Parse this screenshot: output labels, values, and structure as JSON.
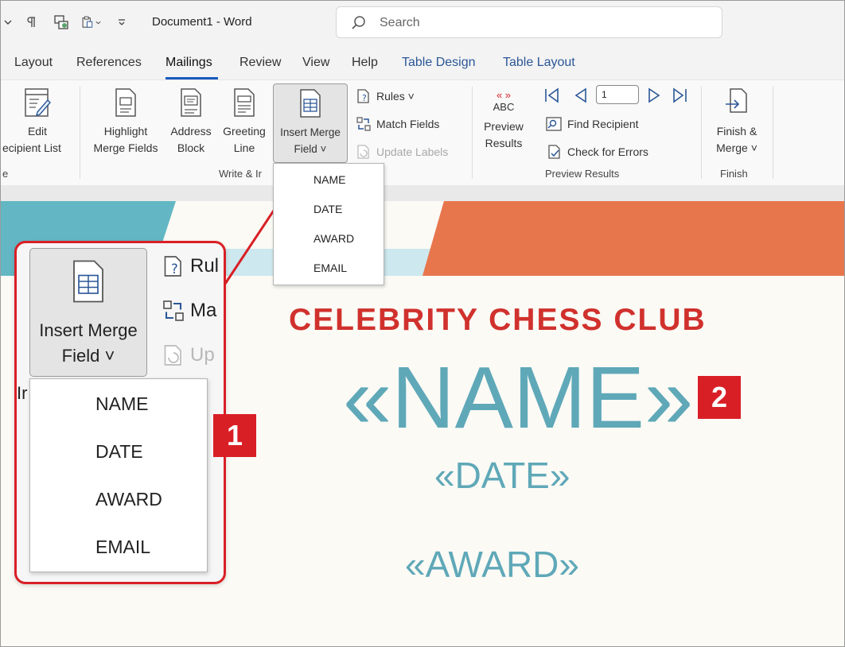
{
  "window": {
    "title": "Document1  -  Word"
  },
  "search": {
    "placeholder": "Search"
  },
  "tabs": [
    {
      "label": "Layout"
    },
    {
      "label": "References"
    },
    {
      "label": "Mailings"
    },
    {
      "label": "Review"
    },
    {
      "label": "View"
    },
    {
      "label": "Help"
    },
    {
      "label": "Table Design"
    },
    {
      "label": "Table Layout"
    }
  ],
  "ribbon": {
    "edit_recipient_label_1": "Edit",
    "edit_recipient_label_2": "ecipient List",
    "highlight_label_1": "Highlight",
    "highlight_label_2": "Merge Fields",
    "address_label_1": "Address",
    "address_label_2": "Block",
    "greeting_label_1": "Greeting",
    "greeting_label_2": "Line",
    "insert_merge_label_1": "Insert Merge",
    "insert_merge_label_2": "Field ˅",
    "rules_label": "Rules ˅",
    "match_fields_label": "Match Fields",
    "update_labels_label": "Update Labels",
    "preview_abc": "ABC",
    "preview_label_1": "Preview",
    "preview_label_2": "Results",
    "record_value": "1",
    "find_recipient_label": "Find Recipient",
    "check_errors_label": "Check for Errors",
    "finish_label_1": "Finish &",
    "finish_label_2": "Merge ˅",
    "group_start_partial": "e",
    "group_write_insert": "Write & Ir",
    "group_preview": "Preview Results",
    "group_finish": "Finish"
  },
  "merge_field_menu": {
    "options": [
      "NAME",
      "DATE",
      "AWARD",
      "EMAIL"
    ]
  },
  "zoom_callout": {
    "button_label_1": "Insert Merge",
    "button_label_2": "Field ˅",
    "rules_partial": "Rul",
    "match_partial": "Ma",
    "update_partial": "Up",
    "group_partial": "Ir",
    "options": [
      "NAME",
      "DATE",
      "AWARD",
      "EMAIL"
    ]
  },
  "document": {
    "club_title": "CELEBRITY CHESS CLUB",
    "name_field": "«NAME»",
    "date_field": "«DATE»",
    "award_field": "«AWARD»"
  },
  "callouts": {
    "one": "1",
    "two": "2"
  },
  "colors": {
    "accent_red": "#d91f26",
    "word_blue": "#185abd",
    "merge_field_teal": "#5fa8b8",
    "title_red": "#d0312d",
    "band_teal": "#63b7c4",
    "band_orange": "#e8764d"
  },
  "icons": [
    "chevron-down-icon",
    "paragraph-mark-icon",
    "compare-icon",
    "clipboard-icon",
    "customize-icon",
    "search-icon"
  ]
}
